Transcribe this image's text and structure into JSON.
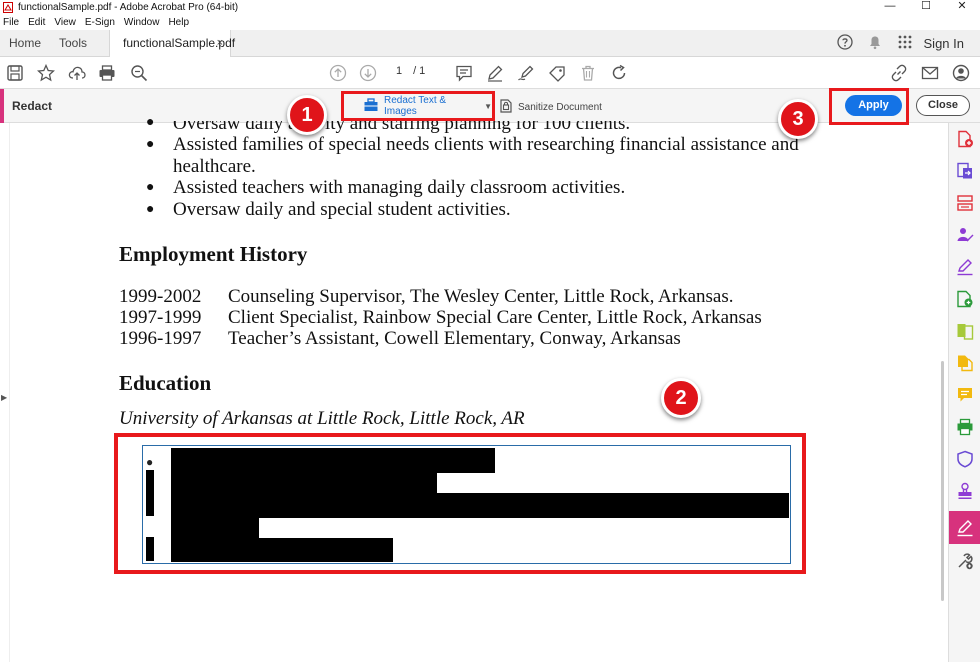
{
  "window": {
    "title": "functionalSample.pdf - Adobe Acrobat Pro (64-bit)",
    "controls": [
      "—",
      "☐",
      "✕"
    ]
  },
  "menu": [
    "File",
    "Edit",
    "View",
    "E-Sign",
    "Window",
    "Help"
  ],
  "tabs": {
    "home": "Home",
    "tools": "Tools",
    "document": "functionalSample.pdf",
    "close_glyph": "×"
  },
  "account": {
    "sign_in": "Sign In"
  },
  "toolbar": {
    "page_current": "1",
    "page_total": "/ 1"
  },
  "redact_bar": {
    "label": "Redact",
    "redact_text_images": "Redact Text & Images",
    "sanitize": "Sanitize Document",
    "apply": "Apply",
    "close": "Close"
  },
  "badges": [
    "1",
    "2",
    "3"
  ],
  "document": {
    "bullets_top": [
      "Oversaw daily activity and staffing planning for 100 clients.",
      "Assisted families of special needs clients with researching financial assistance and",
      "healthcare.",
      "Assisted teachers with managing daily classroom activities.",
      "Oversaw daily and special student activities."
    ],
    "employment_heading": "Employment History",
    "employment": [
      {
        "years": "1999-2002",
        "desc": "Counseling Supervisor, The Wesley Center, Little Rock, Arkansas."
      },
      {
        "years": "1997-1999",
        "desc": "Client Specialist, Rainbow Special Care Center, Little Rock, Arkansas"
      },
      {
        "years": "1996-1997",
        "desc": "Teacher’s Assistant, Cowell Elementary, Conway, Arkansas"
      }
    ],
    "education_heading": "Education",
    "university": "University of Arkansas at Little Rock, Little Rock, AR"
  },
  "colors": {
    "accent_pink": "#d7327d",
    "apply_blue": "#1473e6",
    "callout_red": "#e8191c"
  },
  "right_panel_icons": [
    "create-pdf-icon",
    "export-pdf-icon",
    "organize-pages-icon",
    "request-esign-icon",
    "fill-sign-icon",
    "edit-pdf-icon",
    "compare-files-icon",
    "combine-files-icon",
    "comment-icon",
    "print-production-icon",
    "protect-icon",
    "stamp-icon",
    "redact-icon",
    "more-tools-icon"
  ]
}
